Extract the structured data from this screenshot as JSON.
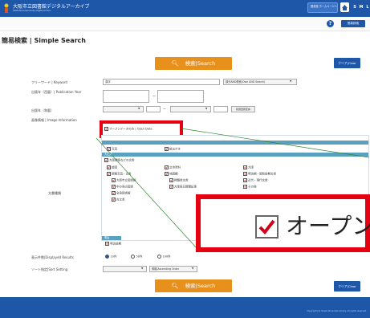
{
  "header": {
    "title": "大阪市立図書館デジタルアーカイブ",
    "subtitle": "Osaka Municipal Library Digital Archive",
    "homepage_btn": "図書館 ホームページへ",
    "font_sizes": [
      "S",
      "M",
      "L"
    ]
  },
  "subbar": {
    "help": "?",
    "back": "簡易検索"
  },
  "page_title": "簡易検索 | Simple Search",
  "search_button": "検索|Search",
  "clear_button": "クリア|Clear",
  "form": {
    "keyword_label": "フリーワード | Keyword",
    "keyword_value": "漢字",
    "keyword_mode": "部分AND検索(Own AND Search)",
    "pubyear_label": "出版年（西暦）| Publication Year",
    "pubyear_tilde": "〜",
    "pubyear2_label": "出版年（和暦）",
    "era_button": "和暦西暦変換",
    "image_info_label": "画像情報 | Image Information",
    "open_data": "オープンデータのみ | Open Data"
  },
  "panel": {
    "bar1": "",
    "bar2": "大正期",
    "bar3": "大阪関係などの文書",
    "items_top": [
      "写真",
      "絵はがき"
    ],
    "col1": [
      "絵図",
      "新聞写真・文書",
      "大阪市立図書館",
      "中の島の図書",
      "全島図書館",
      "古文書",
      "旧版図"
    ],
    "col2": [
      "交渉資料",
      "地図類",
      "稀覯書文書",
      "大阪毎日新聞記事"
    ],
    "col3": [
      "大阪",
      "明治期・昭和前期文書",
      "近代・現代文書",
      "その他"
    ],
    "lower_bar": "明治",
    "lower_item": "明治前期",
    "doc_type_label": "文書種類"
  },
  "results": {
    "label": "表示件数|Displayed Results",
    "options": [
      "10件",
      "50件",
      "100件"
    ],
    "selected": "10件"
  },
  "sort": {
    "label": "ソート指定|Sort Setting",
    "order": "昇順|Ascending Order"
  },
  "zoom_text": "オープン",
  "footer": {
    "copyright": "Copyright (C) Osaka Municipal Library. All rights reserved."
  },
  "colors": {
    "brand_blue": "#1e56a8",
    "search_orange": "#e8901c",
    "highlight_red": "#e50012"
  }
}
